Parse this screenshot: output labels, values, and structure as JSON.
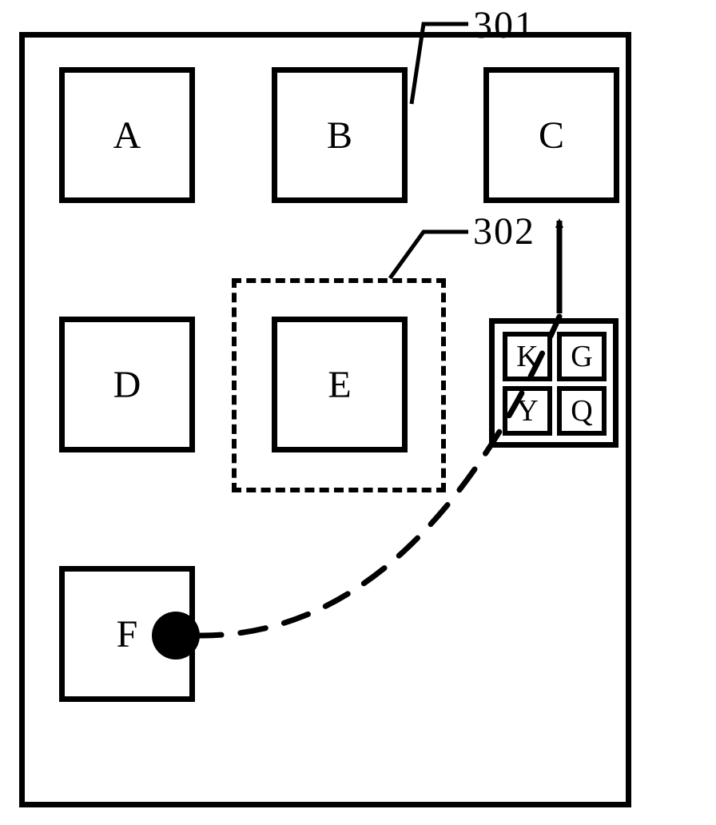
{
  "callouts": {
    "c301": "301",
    "c302": "302"
  },
  "boxes": {
    "A": "A",
    "B": "B",
    "C": "C",
    "D": "D",
    "E": "E",
    "F": "F"
  },
  "folder": {
    "K": "K",
    "G": "G",
    "Y": "Y",
    "Q": "Q"
  }
}
